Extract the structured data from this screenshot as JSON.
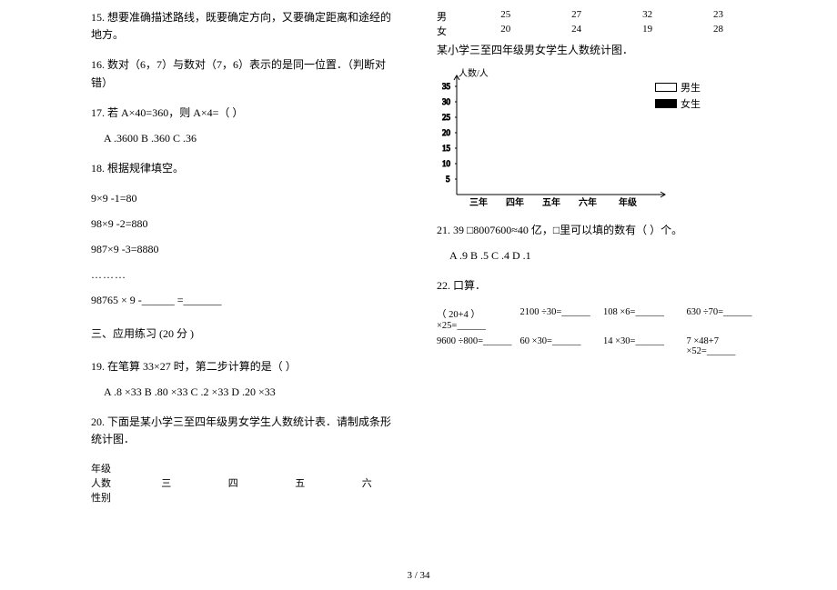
{
  "left": {
    "q15": "15.  想要准确描述路线，既要确定方向，又要确定距离和途经的地方。",
    "q16": "16.  数对（6，7）与数对（7，6）表示的是同一位置．（判断对错）",
    "q17": "17.  若 A×40=360，则 A×4=（ ）",
    "q17opts": "A .3600    B .360    C .36",
    "q18": "18.  根据规律填空。",
    "q18a": "9×9 -1=80",
    "q18b": "98×9 -2=880",
    "q18c": "987×9 -3=8880",
    "q18d": "………",
    "q18e": "98765 × 9 -______ =_______",
    "section3": "三、应用练习  (20  分 )",
    "q19": "19.  在笔算 33×27 时，第二步计算的是（            ）",
    "q19opts": "A .8 ×33    B .80 ×33   C .2 ×33    D .20 ×33",
    "q20": "20.  下面是某小学三至四年级男女学生人数统计表．请制成条形统计图．",
    "t_head_grade": "年级",
    "t_head_count": "人数",
    "t_head_gender": "性别",
    "t_g3": "三",
    "t_g4": "四",
    "t_g5": "五",
    "t_g6": "六"
  },
  "right": {
    "row_male_label": "男",
    "row_female_label": "女",
    "m3": "25",
    "m4": "27",
    "m5": "32",
    "m6": "23",
    "f3": "20",
    "f4": "24",
    "f5": "19",
    "f6": "28",
    "chart_caption": "某小学三至四年级男女学生人数统计图．",
    "ylabel": "人数/人",
    "ticks": {
      "t5": "5",
      "t10": "10",
      "t15": "15",
      "t20": "20",
      "t25": "25",
      "t30": "30",
      "t35": "35"
    },
    "xcats": {
      "g3": "三年",
      "g4": "四年",
      "g5": "五年",
      "g6": "六年",
      "gx": "年级"
    },
    "legend_boy": "男生",
    "legend_girl": "女生",
    "q21": "21. 39 □8007600≈40 亿，□里可以填的数有（            ）个。",
    "q21opts": "A .9    B .5    C .4    D .1",
    "q22": "22.  口算．",
    "calc": {
      "c1": "（    20+4    ）×25=______",
      "c2": "2100 ÷30=______",
      "c3": "108 ×6=______",
      "c4": "630 ÷70=______",
      "c5": "9600 ÷800=______",
      "c6": "60 ×30=______",
      "c7": "14 ×30=______",
      "c8": "7 ×48+7 ×52=______"
    }
  },
  "pager": "3 / 34"
}
